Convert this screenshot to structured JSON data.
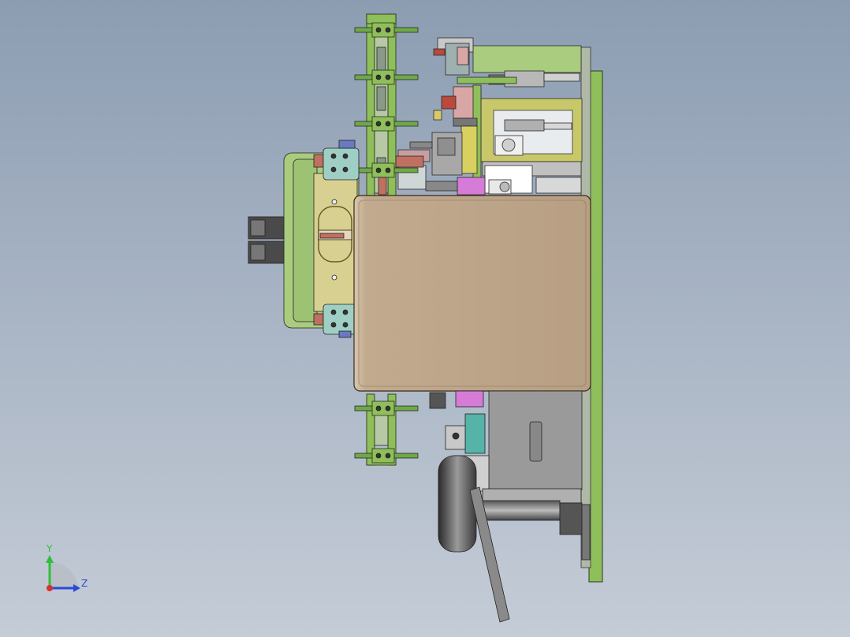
{
  "viewport": {
    "background_top": "#8c9db2",
    "background_bottom": "#c4ccd6"
  },
  "colors": {
    "frame_green": "#8fbf5a",
    "plate_green": "#a9cc7e",
    "light_green": "#c8ddb0",
    "tan_cover": "#bfa88c",
    "olive": "#c8c86a",
    "grey_block": "#9a9a9a",
    "dark_grey": "#4a4a4a",
    "magenta": "#d67bd8",
    "teal": "#55b3a8",
    "red_accent": "#b94a3c",
    "pink": "#d9a6a6"
  },
  "triad": {
    "y_label": "Y",
    "z_label": "Z",
    "y_color": "#2fbf3a",
    "z_color": "#2a4ad8",
    "x_color": "#d83030"
  }
}
